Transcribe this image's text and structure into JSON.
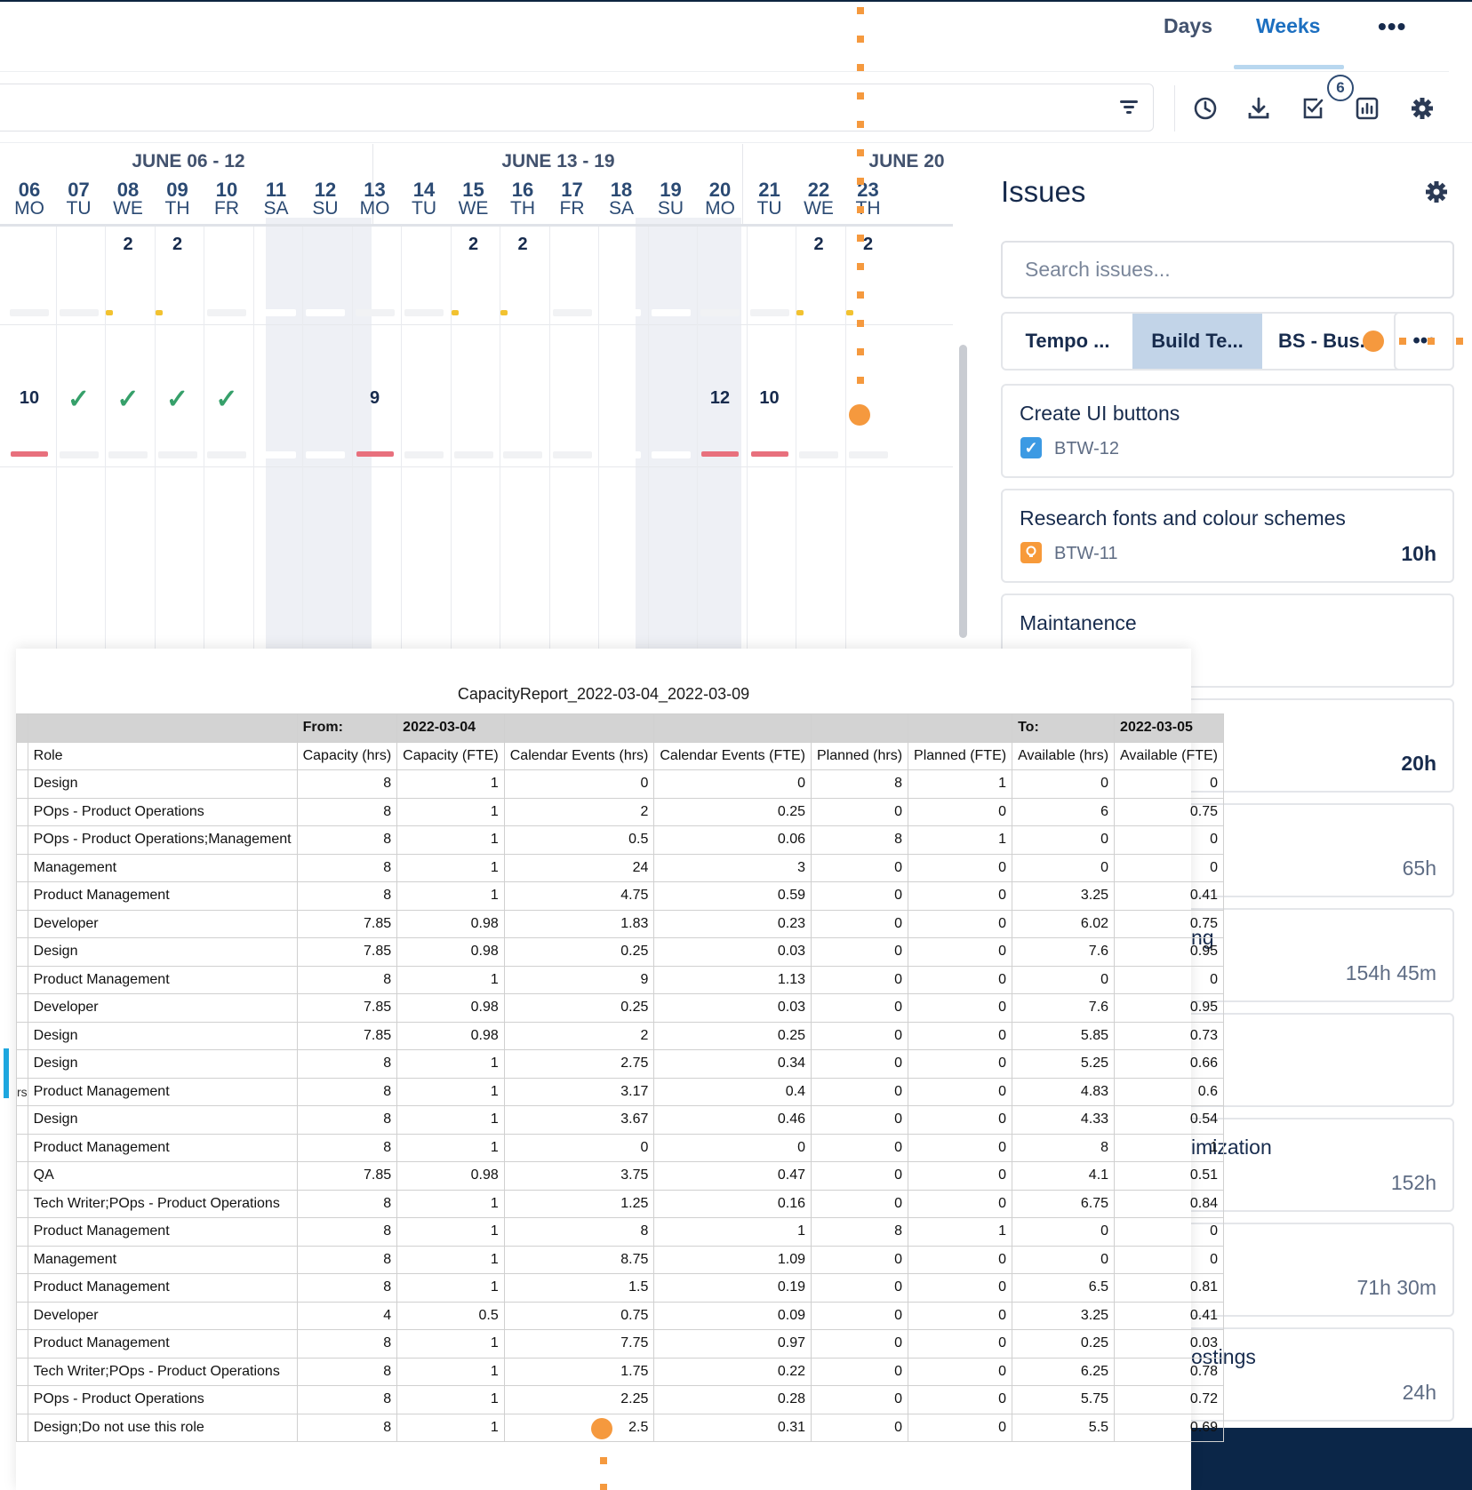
{
  "header": {
    "view_tabs": [
      "Days",
      "Weeks"
    ],
    "active_tab": "Weeks",
    "more_label": "•••"
  },
  "toolbar": {
    "icons": [
      "filter-icon",
      "clock-icon",
      "download-icon",
      "check-icon",
      "chart-icon",
      "gear-icon"
    ],
    "badge_count": "6"
  },
  "calendar": {
    "weeks": [
      "JUNE 06 - 12",
      "JUNE 13 - 19",
      "JUNE 20"
    ],
    "days": [
      {
        "num": "06",
        "dow": "MO"
      },
      {
        "num": "07",
        "dow": "TU"
      },
      {
        "num": "08",
        "dow": "WE"
      },
      {
        "num": "09",
        "dow": "TH"
      },
      {
        "num": "10",
        "dow": "FR"
      },
      {
        "num": "11",
        "dow": "SA"
      },
      {
        "num": "12",
        "dow": "SU"
      },
      {
        "num": "13",
        "dow": "MO"
      },
      {
        "num": "14",
        "dow": "TU"
      },
      {
        "num": "15",
        "dow": "WE"
      },
      {
        "num": "16",
        "dow": "TH"
      },
      {
        "num": "17",
        "dow": "FR"
      },
      {
        "num": "18",
        "dow": "SA"
      },
      {
        "num": "19",
        "dow": "SU"
      },
      {
        "num": "20",
        "dow": "MO"
      },
      {
        "num": "21",
        "dow": "TU"
      },
      {
        "num": "22",
        "dow": "WE"
      },
      {
        "num": "23",
        "dow": "TH"
      }
    ],
    "row1_values": [
      "",
      "",
      "2",
      "2",
      "",
      "",
      "",
      "",
      "",
      "2",
      "2",
      "",
      "",
      "",
      "",
      "",
      "2",
      "2"
    ],
    "row2_values": [
      "10",
      "✓",
      "✓",
      "✓",
      "✓",
      "",
      "",
      "9",
      "",
      "",
      "",
      "",
      "",
      "",
      "12",
      "10",
      "",
      ""
    ]
  },
  "issues": {
    "title": "Issues",
    "search_placeholder": "Search issues...",
    "filters": [
      "Tempo ...",
      "Build Te...",
      "BS - Bus..."
    ],
    "active_filter": "Build Te...",
    "more_label": "•••",
    "cards": [
      {
        "title": "Create UI buttons",
        "key": "BTW-12",
        "time": ""
      },
      {
        "title": "Research fonts and colour schemes",
        "key": "BTW-11",
        "time": "10h"
      },
      {
        "title": "Maintanence",
        "key": "",
        "time": ""
      },
      {
        "title": "",
        "key": "",
        "time": "20h"
      },
      {
        "title": "",
        "key": "",
        "time": "65h"
      },
      {
        "title": "ng",
        "key": "",
        "time": "154h 45m"
      },
      {
        "title": "",
        "key": "",
        "time": ""
      },
      {
        "title": "imization",
        "key": "",
        "time": "152h"
      },
      {
        "title": "",
        "key": "",
        "time": "71h 30m"
      },
      {
        "title": "ostings",
        "key": "",
        "time": "24h"
      }
    ]
  },
  "report": {
    "title": "CapacityReport_2022-03-04_2022-03-09",
    "from_label": "From:",
    "from_date": "2022-03-04",
    "to_label": "To:",
    "to_date": "2022-03-05",
    "stub_fragment": "rs",
    "columns": [
      "Role",
      "Capacity (hrs)",
      "Capacity (FTE)",
      "Calendar Events (hrs)",
      "Calendar Events (FTE)",
      "Planned (hrs)",
      "Planned (FTE)",
      "Available (hrs)",
      "Available (FTE)"
    ],
    "rows": [
      [
        "Design",
        "8",
        "1",
        "0",
        "0",
        "8",
        "1",
        "0",
        "0"
      ],
      [
        "POps - Product Operations",
        "8",
        "1",
        "2",
        "0.25",
        "0",
        "0",
        "6",
        "0.75"
      ],
      [
        "POps - Product Operations;Management",
        "8",
        "1",
        "0.5",
        "0.06",
        "8",
        "1",
        "0",
        "0"
      ],
      [
        "Management",
        "8",
        "1",
        "24",
        "3",
        "0",
        "0",
        "0",
        "0"
      ],
      [
        "Product Management",
        "8",
        "1",
        "4.75",
        "0.59",
        "0",
        "0",
        "3.25",
        "0.41"
      ],
      [
        "Developer",
        "7.85",
        "0.98",
        "1.83",
        "0.23",
        "0",
        "0",
        "6.02",
        "0.75"
      ],
      [
        "Design",
        "7.85",
        "0.98",
        "0.25",
        "0.03",
        "0",
        "0",
        "7.6",
        "0.95"
      ],
      [
        "Product Management",
        "8",
        "1",
        "9",
        "1.13",
        "0",
        "0",
        "0",
        "0"
      ],
      [
        "Developer",
        "7.85",
        "0.98",
        "0.25",
        "0.03",
        "0",
        "0",
        "7.6",
        "0.95"
      ],
      [
        "Design",
        "7.85",
        "0.98",
        "2",
        "0.25",
        "0",
        "0",
        "5.85",
        "0.73"
      ],
      [
        "Design",
        "8",
        "1",
        "2.75",
        "0.34",
        "0",
        "0",
        "5.25",
        "0.66"
      ],
      [
        "Product Management",
        "8",
        "1",
        "3.17",
        "0.4",
        "0",
        "0",
        "4.83",
        "0.6"
      ],
      [
        "Design",
        "8",
        "1",
        "3.67",
        "0.46",
        "0",
        "0",
        "4.33",
        "0.54"
      ],
      [
        "Product Management",
        "8",
        "1",
        "0",
        "0",
        "0",
        "0",
        "8",
        "1"
      ],
      [
        "QA",
        "7.85",
        "0.98",
        "3.75",
        "0.47",
        "0",
        "0",
        "4.1",
        "0.51"
      ],
      [
        "Tech Writer;POps - Product Operations",
        "8",
        "1",
        "1.25",
        "0.16",
        "0",
        "0",
        "6.75",
        "0.84"
      ],
      [
        "Product Management",
        "8",
        "1",
        "8",
        "1",
        "8",
        "1",
        "0",
        "0"
      ],
      [
        "Management",
        "8",
        "1",
        "8.75",
        "1.09",
        "0",
        "0",
        "0",
        "0"
      ],
      [
        "Product Management",
        "8",
        "1",
        "1.5",
        "0.19",
        "0",
        "0",
        "6.5",
        "0.81"
      ],
      [
        "Developer",
        "4",
        "0.5",
        "0.75",
        "0.09",
        "0",
        "0",
        "3.25",
        "0.41"
      ],
      [
        "Product Management",
        "8",
        "1",
        "7.75",
        "0.97",
        "0",
        "0",
        "0.25",
        "0.03"
      ],
      [
        "Tech Writer;POps - Product Operations",
        "8",
        "1",
        "1.75",
        "0.22",
        "0",
        "0",
        "6.25",
        "0.78"
      ],
      [
        "POps - Product Operations",
        "8",
        "1",
        "2.25",
        "0.28",
        "0",
        "0",
        "5.75",
        "0.72"
      ],
      [
        "Design;Do not use this role",
        "8",
        "1",
        "2.5",
        "0.31",
        "0",
        "0",
        "5.5",
        "0.69"
      ]
    ]
  },
  "colors": {
    "accent": "#1c6fc0",
    "annotation": "#f5993e",
    "footer": "#0b2648",
    "check": "#36a06a",
    "over_capacity": "#e8707d",
    "under_capacity": "#f2c230"
  }
}
